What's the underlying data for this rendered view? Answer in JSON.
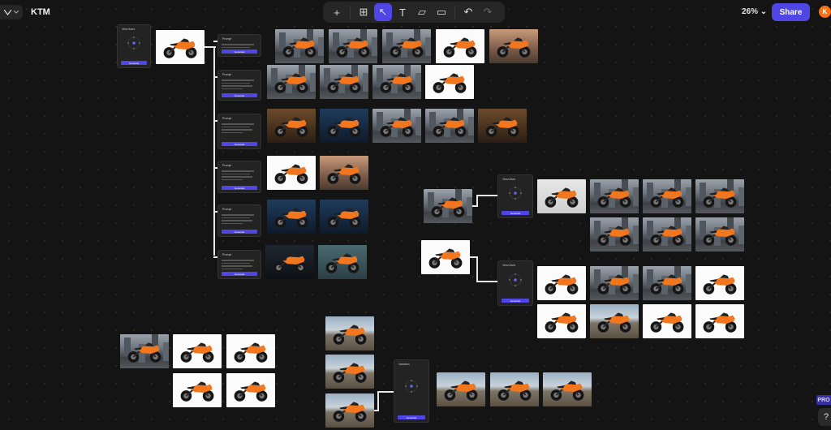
{
  "header": {
    "project_name": "KTM",
    "zoom": "26%",
    "zoom_caret": "⌄",
    "share_label": "Share",
    "avatar_initial": "K"
  },
  "toolbar": {
    "tools": [
      {
        "name": "add-tool",
        "glyph": "+"
      },
      {
        "name": "assets-tool",
        "glyph": "⊞"
      },
      {
        "name": "select-tool",
        "glyph": "↖",
        "active": true
      },
      {
        "name": "text-tool",
        "glyph": "T"
      },
      {
        "name": "sticky-tool",
        "glyph": "▱"
      },
      {
        "name": "frame-tool",
        "glyph": "▭"
      },
      {
        "name": "undo-tool",
        "glyph": "↶"
      },
      {
        "name": "redo-tool",
        "glyph": "↷",
        "disabled": true
      }
    ]
  },
  "nodes": {
    "view_title": "View Axes",
    "prompt_title": "Prompt",
    "variation_title": "Variation",
    "generate_label": "Generate"
  },
  "badges": {
    "pro": "PRO",
    "help": "?"
  },
  "colors": {
    "accent": "#4f46e5",
    "bike_orange": "#f2761e",
    "canvas": "#141414"
  }
}
